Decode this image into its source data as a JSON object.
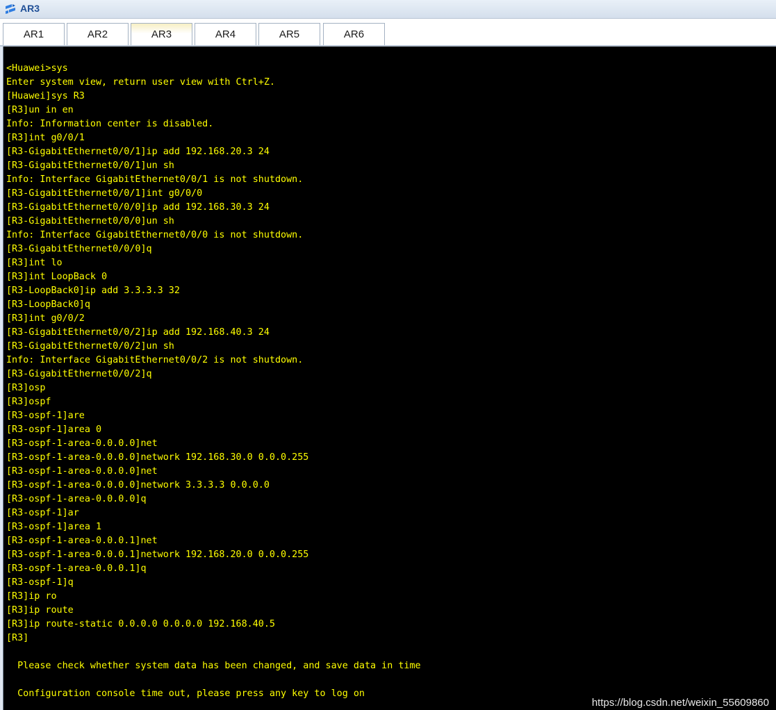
{
  "window": {
    "title": "AR3",
    "icon": "ensp-router-icon"
  },
  "tabs": [
    {
      "label": "AR1",
      "active": false
    },
    {
      "label": "AR2",
      "active": false
    },
    {
      "label": "AR3",
      "active": true
    },
    {
      "label": "AR4",
      "active": false
    },
    {
      "label": "AR5",
      "active": false
    },
    {
      "label": "AR6",
      "active": false
    }
  ],
  "terminal": {
    "text_color": "#ffff00",
    "background": "#000000",
    "lines": [
      "<Huawei>sys",
      "Enter system view, return user view with Ctrl+Z.",
      "[Huawei]sys R3",
      "[R3]un in en",
      "Info: Information center is disabled.",
      "[R3]int g0/0/1",
      "[R3-GigabitEthernet0/0/1]ip add 192.168.20.3 24",
      "[R3-GigabitEthernet0/0/1]un sh",
      "Info: Interface GigabitEthernet0/0/1 is not shutdown.",
      "[R3-GigabitEthernet0/0/1]int g0/0/0",
      "[R3-GigabitEthernet0/0/0]ip add 192.168.30.3 24",
      "[R3-GigabitEthernet0/0/0]un sh",
      "Info: Interface GigabitEthernet0/0/0 is not shutdown.",
      "[R3-GigabitEthernet0/0/0]q",
      "[R3]int lo",
      "[R3]int LoopBack 0",
      "[R3-LoopBack0]ip add 3.3.3.3 32",
      "[R3-LoopBack0]q",
      "[R3]int g0/0/2",
      "[R3-GigabitEthernet0/0/2]ip add 192.168.40.3 24",
      "[R3-GigabitEthernet0/0/2]un sh",
      "Info: Interface GigabitEthernet0/0/2 is not shutdown.",
      "[R3-GigabitEthernet0/0/2]q",
      "[R3]osp",
      "[R3]ospf",
      "[R3-ospf-1]are",
      "[R3-ospf-1]area 0",
      "[R3-ospf-1-area-0.0.0.0]net",
      "[R3-ospf-1-area-0.0.0.0]network 192.168.30.0 0.0.0.255",
      "[R3-ospf-1-area-0.0.0.0]net",
      "[R3-ospf-1-area-0.0.0.0]network 3.3.3.3 0.0.0.0",
      "[R3-ospf-1-area-0.0.0.0]q",
      "[R3-ospf-1]ar",
      "[R3-ospf-1]area 1",
      "[R3-ospf-1-area-0.0.0.1]net",
      "[R3-ospf-1-area-0.0.0.1]network 192.168.20.0 0.0.0.255",
      "[R3-ospf-1-area-0.0.0.1]q",
      "[R3-ospf-1]q",
      "[R3]ip ro",
      "[R3]ip route",
      "[R3]ip route-static 0.0.0.0 0.0.0.0 192.168.40.5",
      "[R3]",
      "",
      "  Please check whether system data has been changed, and save data in time",
      "",
      "  Configuration console time out, please press any key to log on"
    ]
  },
  "watermark": "https://blog.csdn.net/weixin_55609860"
}
